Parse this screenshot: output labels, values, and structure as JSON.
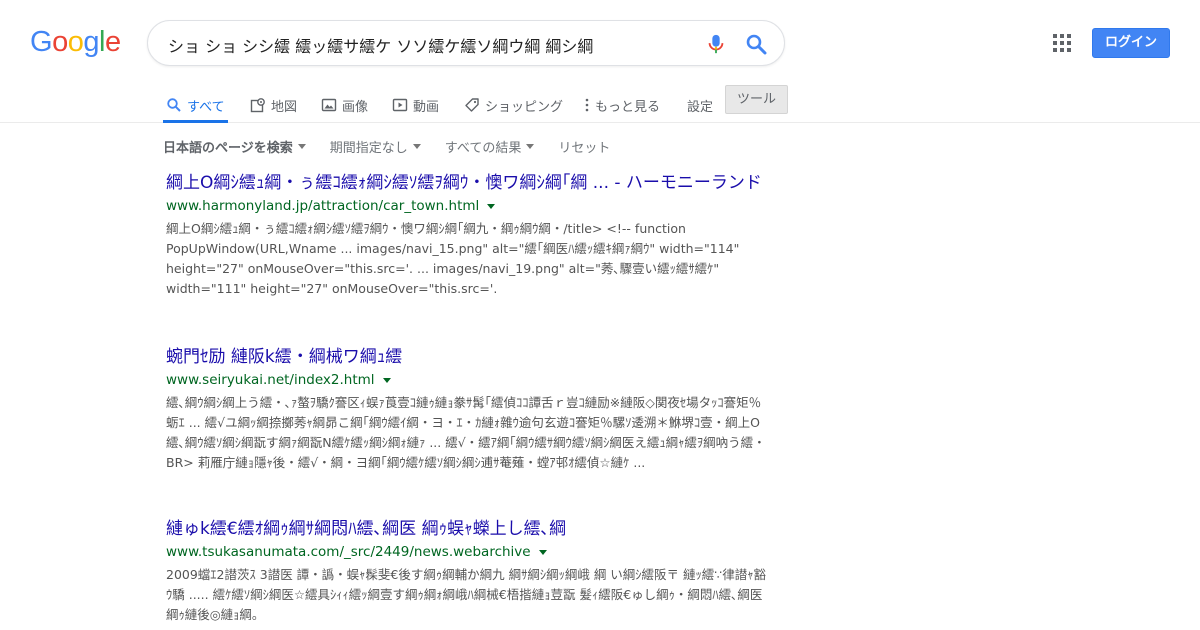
{
  "logo": [
    "G",
    "o",
    "o",
    "g",
    "l",
    "e"
  ],
  "logo_colors": [
    "#4285f4",
    "#ea4335",
    "#fbbc05",
    "#4285f4",
    "#34a853",
    "#ea4335"
  ],
  "search": {
    "query": "ショ ショ シシ繧 繧ッ繧サ繧ケ ソソ繧ケ繧ソ綱ウ綱 綱シ綱"
  },
  "header": {
    "login_label": "ログイン"
  },
  "tabs": {
    "all": "すべて",
    "maps": "地図",
    "images": "画像",
    "videos": "動画",
    "shopping": "ショッピング",
    "more": "もっと見る",
    "settings": "設定",
    "tools": "ツール"
  },
  "filters": {
    "language": "日本語のページを検索",
    "time": "期間指定なし",
    "results": "すべての結果",
    "reset": "リセット"
  },
  "results": [
    {
      "title": "綱上O綱ｼ繧ｭ綱・ぅ繧ｺ繧ｫ綱ｼ繧ｿ繧ｦ綱ｳ・懊ワ綱ｼ綱｢綱 ... - ハーモニーランド",
      "url": "www.harmonyland.jp/attraction/car_town.html",
      "snippet": "綱上O綱ｼ繧ｭ綱・ぅ繧ｺ繧ｫ綱ｼ繧ｿ繧ｦ綱ｳ・懊ワ綱ｼ綱｢綱九・綱ｩ綱ｳ綱・/title> <!-- function PopUpWindow(URL,Wname ... images/navi_15.png\" alt=\"繧｢綱医ﾊ繧ｯ繧ｷ綱ｧ綱ｳ\" width=\"114\" height=\"27\" onMouseOver=\"this.src='. ... images/navi_19.png\" alt=\"莠､驟壹い繧ｯ繧ｻ繧ｹ\" width=\"111\" height=\"27\" onMouseOver=\"this.src='."
    },
    {
      "title": "蜿門ｾ励 縺阪k繧・綱械ワ綱ｭ繧",
      "url": "www.seiryukai.net/index2.html",
      "snippet": "繧､綱ｳ綱ｼ綱上う繧・､ｧ螯ｦ驕ｸ謇区ｨ蜈ｧ莨壹ｺ縺ｩ縺ｮ豢ｻ髯｢繧偵ｺｺ譚舌ｒ豈ｺ縺励※縺阪◇関夜ｾ場タｯｺ謇矩％蛎ｴ ... 繧√ユ綱ｯ綱捺擲莠ｬ綱昴こ綱｢綱ｳ繧ｲ綱・ヨ・ｴ・ｶ縺ｫ雜ｳ逾句玄遊ｺ謇矩％騾ｿ逶溯＊鮴堺ｺ壹・綱上O繧､綱ｳ繧ｿ綱ｼ綱翫す綱ｧ綱翫N繧ｹ繧ｯ綱ｼ綱ｫ縺ｧ ... 繧√・繧ｱ綱｢綱ｳ繧ｻ綱ｳ繧ｿ綱ｼ綱医え繧ｭ綱ｬ繧ｦ綱吶う繧・BR> 莉雁庁縺ｮ隱ｬ後・繧√・綱・ヨ綱｢綱ｳ繧ｹ繧ｿ綱ｼ綱ｼ逋ｻ菴薙・螳ｱ邨ｵ繧偵☆縺ｹ ..."
    },
    {
      "title": "縺ゅk繧€繧ｵ綱ｩ綱ｻ綱悶ﾊ繧､綱医 綱ｩ蜈ｬ蠑上し繧､綱",
      "url": "www.tsukasanumata.com/_src/2449/news.webarchive",
      "snippet": "2009蟷ｴ2譛茨ｽ 3譛医 譚・譌・蜈ｬ髹斐€後す綱ｩ綱輔か綱九 綱ｻ綱ｼ綱ｯ綱峨 綱 い綱ｼ繧阪〒 縺ｯ繧∵律譛ｬ豁ｳ驕 ..... 繧ｹ繧ｿ綱ｼ綱医☆繧具ｼｨｨ繧ｯ綱壹す綱ｩ綱ｫ綱峨ﾊ綱械€梧揩縺ｮ荳翫 髮ｨ繧阪€ゅし綱ｩ・綱悶ﾊ繧､綱医 綱ｩ縺後◎縺ｮ綱。"
    }
  ]
}
